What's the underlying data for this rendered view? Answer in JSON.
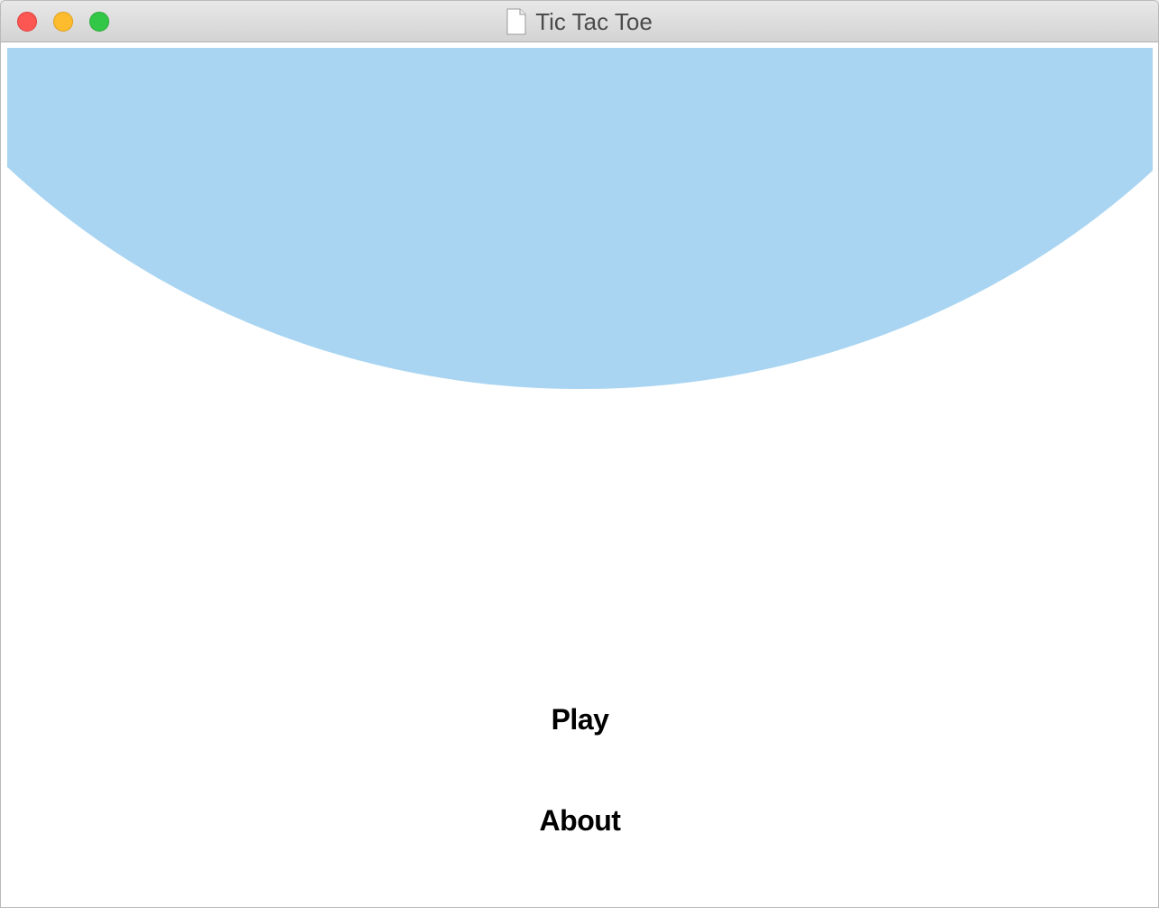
{
  "window": {
    "title": "Tic Tac Toe"
  },
  "colors": {
    "banner": "#a9d5f2",
    "background": "#ffffff",
    "text": "#000000"
  },
  "menu": {
    "play_label": "Play",
    "about_label": "About"
  }
}
